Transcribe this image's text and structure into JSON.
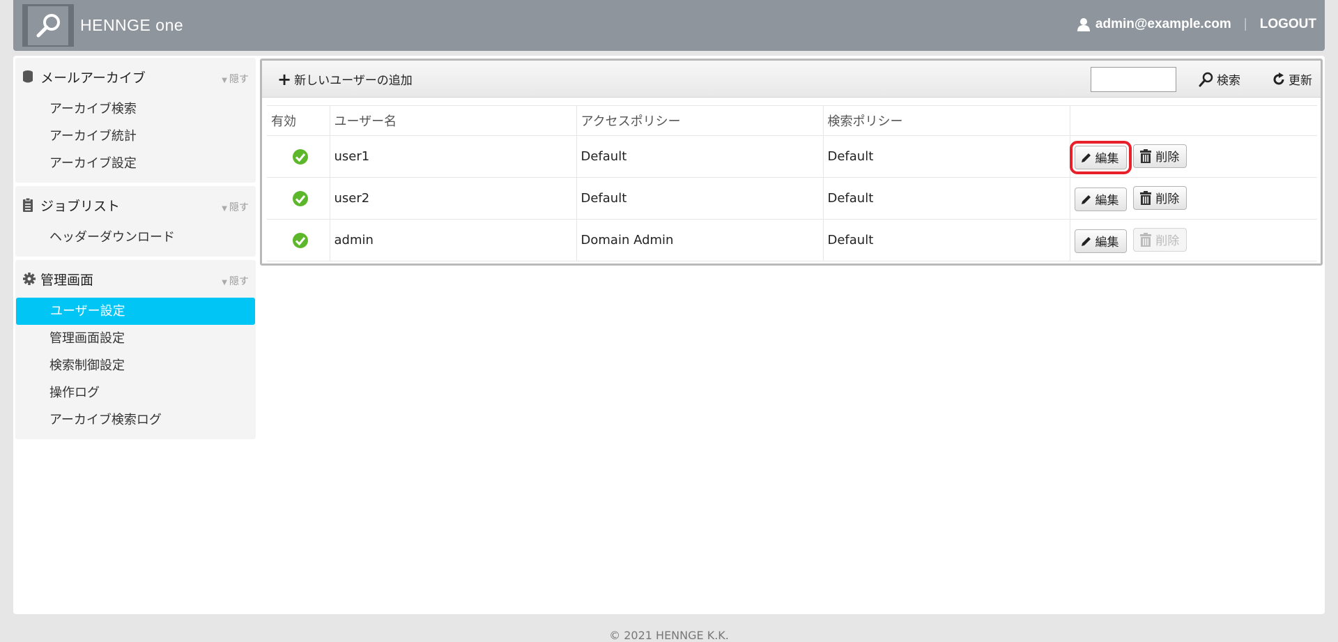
{
  "header": {
    "brand": "HENNGE one",
    "user_email": "admin@example.com",
    "separator": "|",
    "logout": "LOGOUT"
  },
  "sidebar": {
    "groups": [
      {
        "title": "メールアーカイブ",
        "hide": "隠す",
        "items": [
          "アーカイブ検索",
          "アーカイブ統計",
          "アーカイブ設定"
        ]
      },
      {
        "title": "ジョブリスト",
        "hide": "隠す",
        "items": [
          "ヘッダーダウンロード"
        ]
      },
      {
        "title": "管理画面",
        "hide": "隠す",
        "items": [
          "ユーザー設定",
          "管理画面設定",
          "検索制御設定",
          "操作ログ",
          "アーカイブ検索ログ"
        ]
      }
    ],
    "active_item": "ユーザー設定"
  },
  "toolbar": {
    "add_user": "新しいユーザーの追加",
    "search_value": "",
    "search_label": "検索",
    "refresh_label": "更新"
  },
  "table": {
    "headers": [
      "有効",
      "ユーザー名",
      "アクセスポリシー",
      "検索ポリシー",
      ""
    ],
    "rows": [
      {
        "enabled": true,
        "username": "user1",
        "access_policy": "Default",
        "search_policy": "Default",
        "edit": "編集",
        "delete": "削除",
        "delete_disabled": false
      },
      {
        "enabled": true,
        "username": "user2",
        "access_policy": "Default",
        "search_policy": "Default",
        "edit": "編集",
        "delete": "削除",
        "delete_disabled": false
      },
      {
        "enabled": true,
        "username": "admin",
        "access_policy": "Domain Admin",
        "search_policy": "Default",
        "edit": "編集",
        "delete": "削除",
        "delete_disabled": true
      }
    ]
  },
  "colors": {
    "header_bg": "#8e959c",
    "active_item": "#00c5f5",
    "enabled_check": "#5cb82a",
    "highlight": "#e8202a"
  },
  "footer": {
    "copyright": "© 2021 HENNGE K.K."
  }
}
